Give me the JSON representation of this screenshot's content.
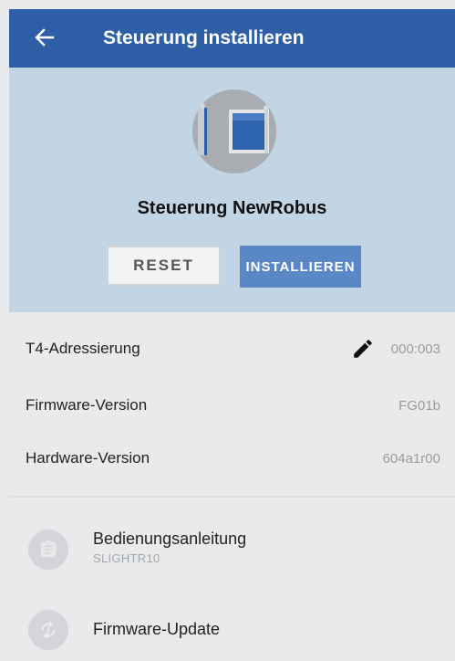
{
  "header": {
    "title": "Steuerung installieren",
    "back_icon": "arrow-left-icon",
    "background": "#2d5ea6"
  },
  "device": {
    "name": "Steuerung NewRobus",
    "image_icon": "motor-controller-icon",
    "reset_label": "RESET",
    "install_label": "INSTALLIEREN",
    "hero_background": "#c2d5e5",
    "install_color": "#5a87c6"
  },
  "details": [
    {
      "label": "T4-Adressierung",
      "value": "000:003",
      "icon": "pencil-icon"
    },
    {
      "label": "Firmware-Version",
      "value": "FG01b"
    },
    {
      "label": "Hardware-Version",
      "value": "604a1r00"
    }
  ],
  "actions": [
    {
      "title": "Bedienungsanleitung",
      "subtitle": "SLIGHTR10",
      "icon": "clipboard-icon"
    },
    {
      "title": "Firmware-Update",
      "icon": "update-icon"
    }
  ]
}
